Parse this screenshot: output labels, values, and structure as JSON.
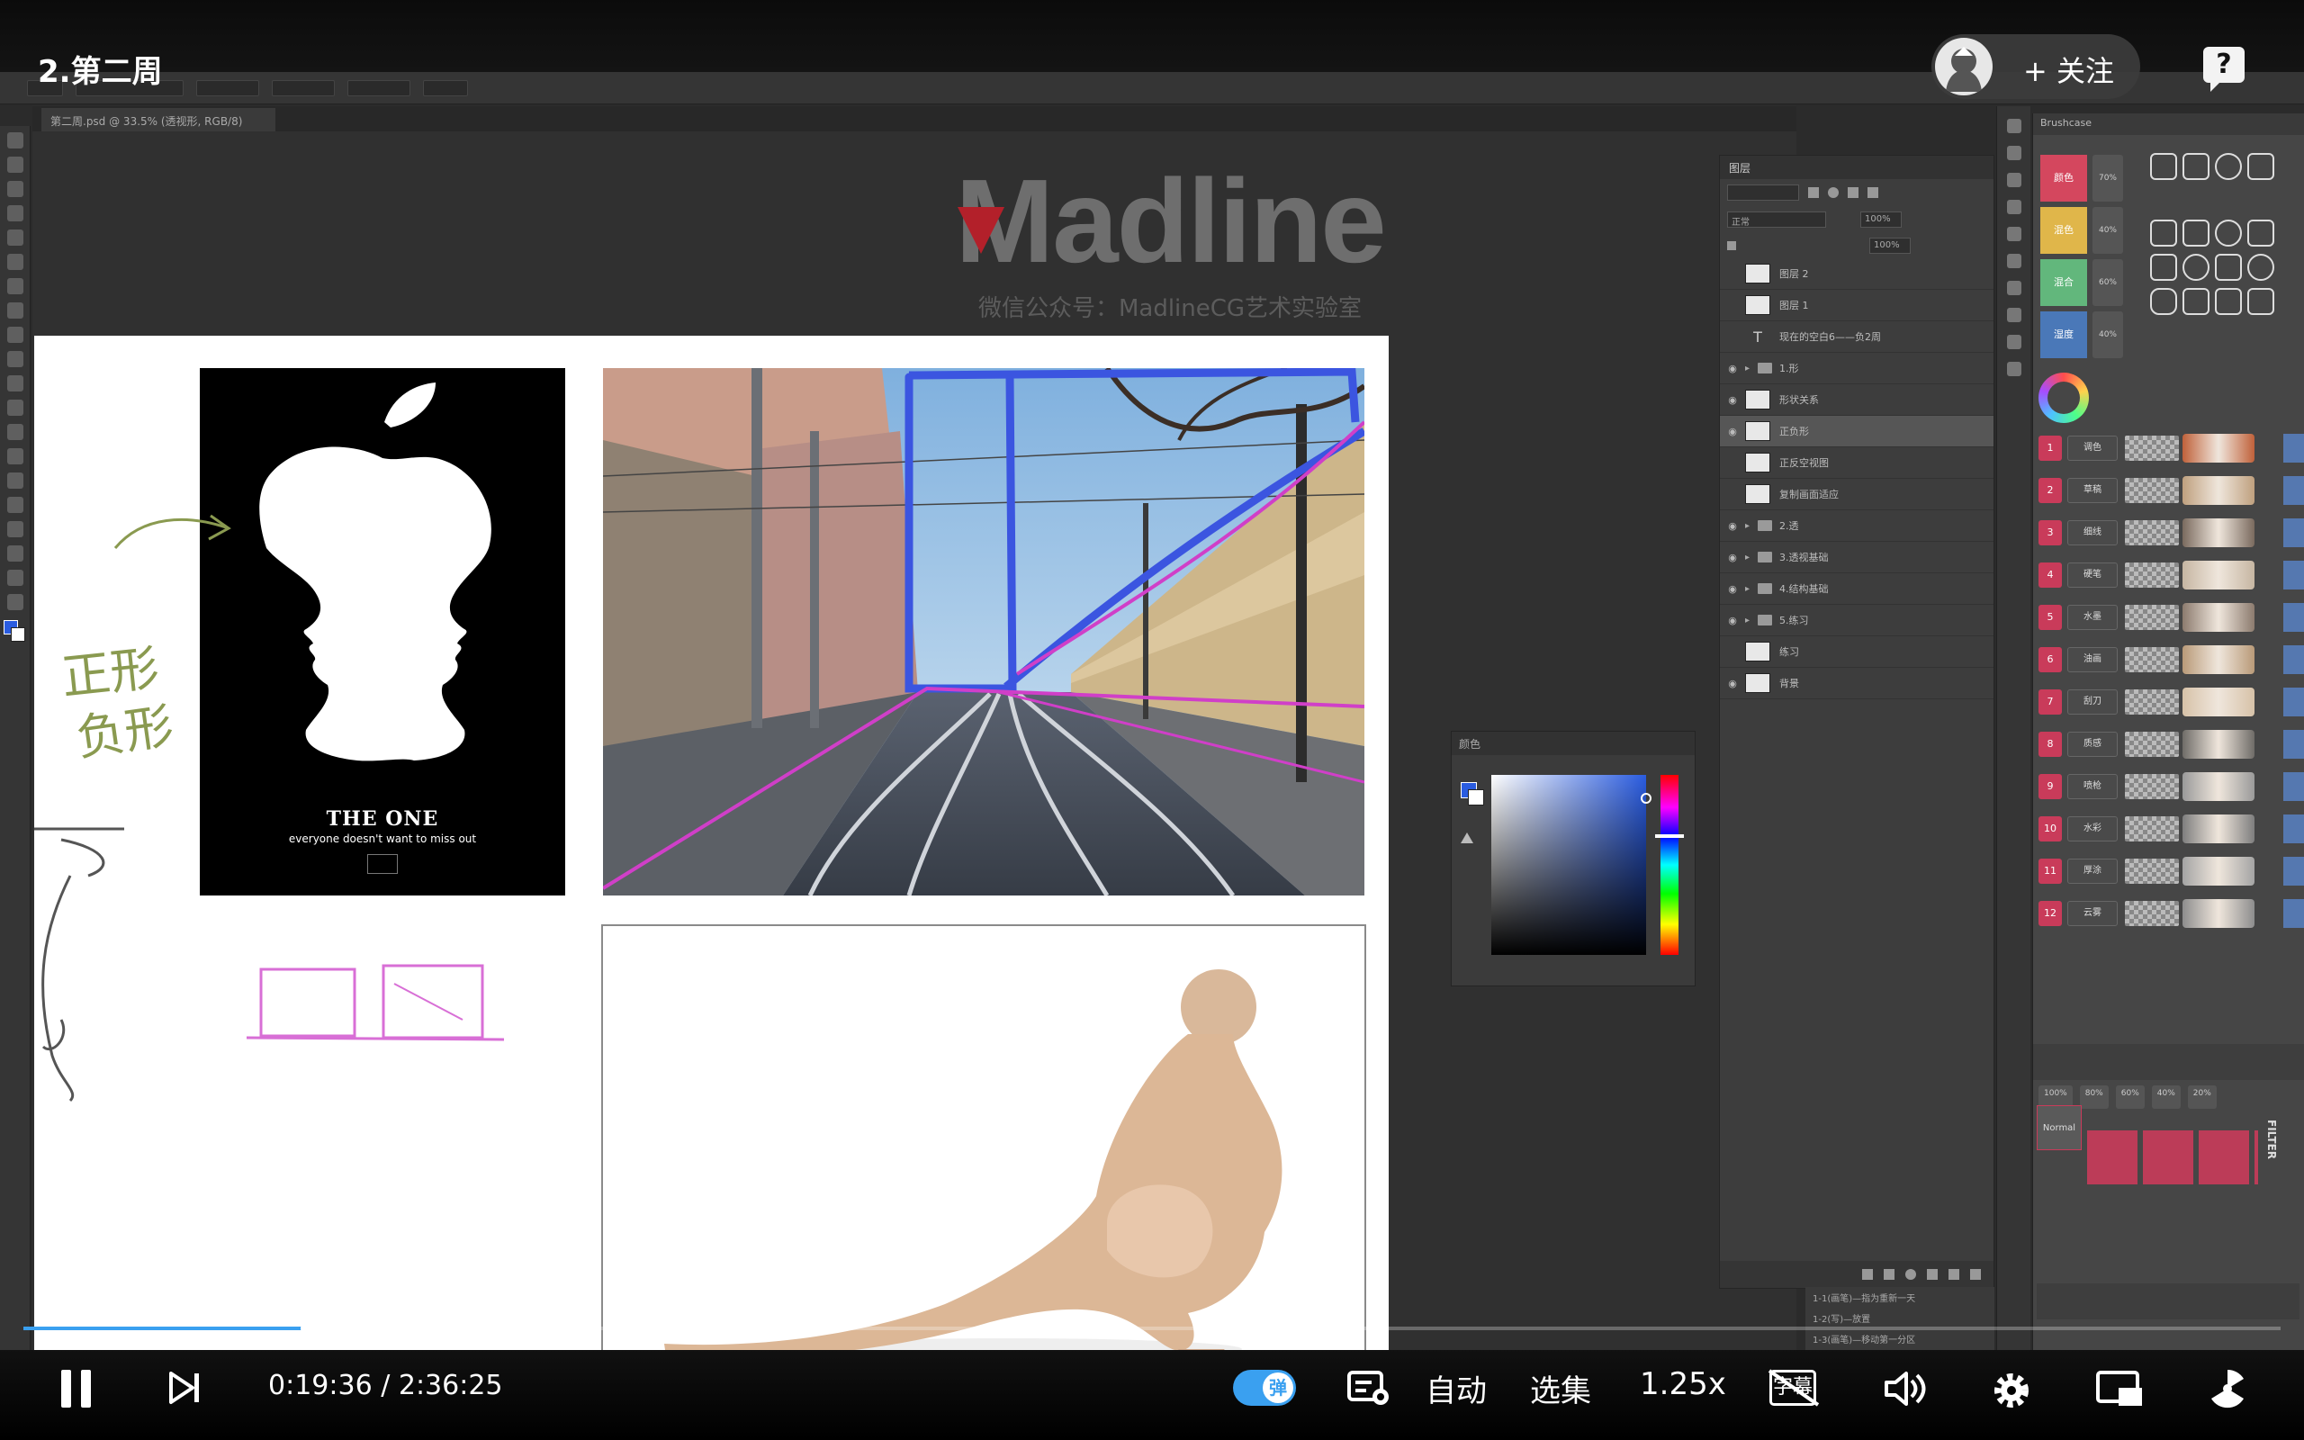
{
  "video": {
    "title": "2.第二周",
    "follow_label": "+ 关注",
    "help_label": "?",
    "time_current": "0:19:36",
    "time_separator": "/",
    "time_total": "2:36:25",
    "progress_fraction": 0.125,
    "danmu_label": "弹",
    "auto_label": "自动",
    "episodes_label": "选集",
    "speed_label": "1.25x",
    "subtitle_label": "字幕",
    "accent_color": "#3aa0f0"
  },
  "photoshop": {
    "document_tab": "第二周.psd @ 33.5% (透视形, RGB/8)",
    "watermark": {
      "title": "Madline",
      "subtitle": "微信公众号：MadlineCG艺术实验室",
      "brand_color": "#b3202a"
    },
    "poster": {
      "headline": "THE ONE",
      "tagline": "everyone doesn't want to miss out"
    },
    "handwriting": {
      "positive_shape": "正形",
      "negative_shape": "负形"
    },
    "color_panel": {
      "title": "颜色",
      "foreground_color": "#2a5ce0"
    },
    "layers_panel": {
      "tab_label": "图层",
      "blend_mode": "正常",
      "opacity": "100%",
      "fill": "100%",
      "layers": [
        {
          "name": "图层 2",
          "type": "layer",
          "visible": false
        },
        {
          "name": "图层 1",
          "type": "layer",
          "visible": false
        },
        {
          "name": "现在的空白6——负2周",
          "type": "text",
          "visible": false
        },
        {
          "name": "1.形",
          "type": "group",
          "visible": true
        },
        {
          "name": "形状关系",
          "type": "layer",
          "visible": true
        },
        {
          "name": "正负形",
          "type": "layer",
          "visible": true,
          "active": true
        },
        {
          "name": "正反空视图",
          "type": "layer",
          "visible": false
        },
        {
          "name": "复制画面适应",
          "type": "layer",
          "visible": false
        },
        {
          "name": "2.透",
          "type": "group",
          "visible": true
        },
        {
          "name": "3.透视基础",
          "type": "group",
          "visible": true
        },
        {
          "name": "4.结构基础",
          "type": "group",
          "visible": true
        },
        {
          "name": "5.练习",
          "type": "group",
          "visible": true
        },
        {
          "name": "练习",
          "type": "layer",
          "visible": false
        },
        {
          "name": "背景",
          "type": "background",
          "visible": true
        }
      ]
    },
    "history_items": [
      "1-1(画笔)—指为重新一天",
      "1-2(写)—放置",
      "1-3(画笔)—移动第一分区"
    ],
    "brushcase": {
      "title": "Brushcase",
      "swatches": [
        {
          "label": "颜色",
          "pct": "70%",
          "color": "#d4475e"
        },
        {
          "label": "混色",
          "pct": "40%",
          "color": "#e0b64a"
        },
        {
          "label": "混合",
          "pct": "60%",
          "color": "#62b77c"
        },
        {
          "label": "湿度",
          "pct": "40%",
          "color": "#4a78b8"
        }
      ],
      "brushes": [
        {
          "num": "1",
          "label": "调色"
        },
        {
          "num": "2",
          "label": "草稿"
        },
        {
          "num": "3",
          "label": "细线"
        },
        {
          "num": "4",
          "label": "硬笔"
        },
        {
          "num": "5",
          "label": "水墨"
        },
        {
          "num": "6",
          "label": "油画"
        },
        {
          "num": "7",
          "label": "刮刀"
        },
        {
          "num": "8",
          "label": "质感"
        },
        {
          "num": "9",
          "label": "喷枪"
        },
        {
          "num": "10",
          "label": "水彩"
        },
        {
          "num": "11",
          "label": "厚涂"
        },
        {
          "num": "12",
          "label": "云雾"
        }
      ],
      "blend_label": "Normal",
      "filter_label": "FILTER",
      "zoom_steps": [
        "100%",
        "80%",
        "60%",
        "40%",
        "20%"
      ]
    }
  }
}
